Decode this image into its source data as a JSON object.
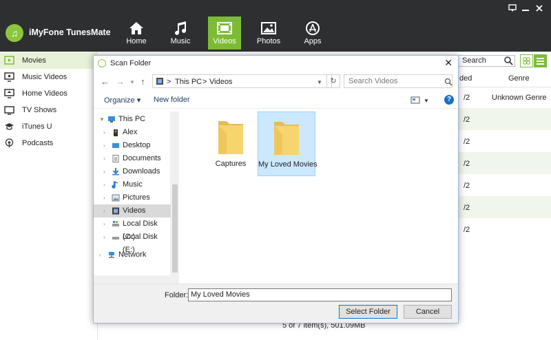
{
  "app": {
    "title": "iMyFone TunesMate",
    "accent": "#7dbb37",
    "nav": [
      {
        "label": "Home",
        "icon": "home-icon"
      },
      {
        "label": "Music",
        "icon": "music-icon"
      },
      {
        "label": "Videos",
        "icon": "video-icon",
        "active": true
      },
      {
        "label": "Photos",
        "icon": "photo-icon"
      },
      {
        "label": "Apps",
        "icon": "apps-icon"
      }
    ],
    "sidebar": [
      {
        "label": "Movies",
        "icon": "movie-icon",
        "active": true
      },
      {
        "label": "Music Videos",
        "icon": "music-video-icon"
      },
      {
        "label": "Home Videos",
        "icon": "home-video-icon"
      },
      {
        "label": "TV Shows",
        "icon": "tv-icon"
      },
      {
        "label": "iTunes U",
        "icon": "graduation-cap-icon"
      },
      {
        "label": "Podcasts",
        "icon": "podcast-icon"
      }
    ],
    "search_placeholder": "Search",
    "columns": {
      "c1": "ded",
      "c2": "Genre"
    },
    "rows": [
      {
        "v": "/2",
        "genre": "Unknown Genre"
      },
      {
        "v": "/2",
        "genre": ""
      },
      {
        "v": "/2",
        "genre": ""
      },
      {
        "v": "/2",
        "genre": ""
      },
      {
        "v": "/2",
        "genre": ""
      },
      {
        "v": "/2",
        "genre": ""
      },
      {
        "v": "/2",
        "genre": ""
      }
    ],
    "status": "5 of 7 item(s), 501.09MB"
  },
  "dialog": {
    "title": "Scan Folder",
    "path": [
      "This PC",
      "Videos"
    ],
    "search_placeholder": "Search Videos",
    "organize": "Organize",
    "new_folder": "New folder",
    "tree": [
      {
        "label": "This PC",
        "icon": "computer-icon",
        "level": 0,
        "expanded": true
      },
      {
        "label": "Alex",
        "icon": "user-folder-icon",
        "level": 1
      },
      {
        "label": "Desktop",
        "icon": "desktop-folder-icon",
        "level": 1
      },
      {
        "label": "Documents",
        "icon": "documents-folder-icon",
        "level": 1
      },
      {
        "label": "Downloads",
        "icon": "downloads-folder-icon",
        "level": 1
      },
      {
        "label": "Music",
        "icon": "music-folder-icon",
        "level": 1
      },
      {
        "label": "Pictures",
        "icon": "pictures-folder-icon",
        "level": 1
      },
      {
        "label": "Videos",
        "icon": "videos-folder-icon",
        "level": 1,
        "selected": true
      },
      {
        "label": "Local Disk (C:)",
        "icon": "drive-icon",
        "level": 1
      },
      {
        "label": "Local Disk (E:)",
        "icon": "drive-icon",
        "level": 1
      },
      {
        "label": "Network",
        "icon": "network-icon",
        "level": 0
      }
    ],
    "files": [
      {
        "name": "Captures",
        "selected": false
      },
      {
        "name": "My Loved Movies",
        "selected": true
      }
    ],
    "folder_label": "Folder:",
    "folder_value": "My Loved Movies",
    "select_button": "Select Folder",
    "cancel_button": "Cancel"
  }
}
